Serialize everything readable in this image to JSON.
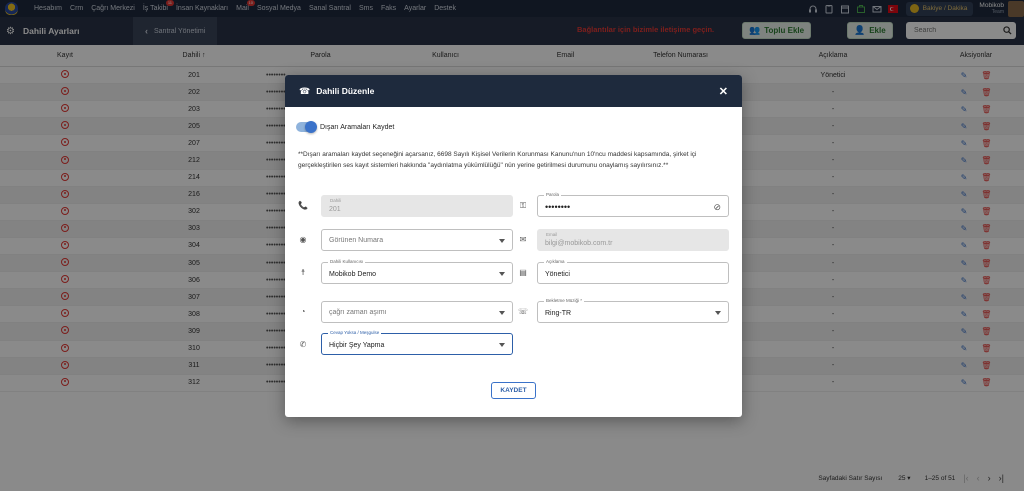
{
  "nav": {
    "items": [
      "Hesabım",
      "Crm",
      "Çağrı Merkezi",
      "İş Takibi",
      "İnsan Kaynakları",
      "Mail",
      "Sosyal Medya",
      "Sanal Santral",
      "Sms",
      "Faks",
      "Ayarlar",
      "Destek"
    ],
    "badges": {
      "is_takibi": "11",
      "mail": "10"
    },
    "bakiye_label": "Bakiye / Dakika",
    "user_name": "Mobikob",
    "user_sub": "Team"
  },
  "subhead": {
    "page_title": "Dahili Ayarları",
    "back_label": "Santral Yönetimi",
    "contact_note": "Bağlantılar için bizimle iletişime geçin.",
    "bulk_add_label": "Toplu Ekle",
    "add_label": "Ekle",
    "search_placeholder": "Search"
  },
  "table": {
    "headers": [
      "Kayıt",
      "Dahili ↑",
      "Parola",
      "Kullanıcı",
      "Email",
      "Telefon Numarası",
      "Açıklama",
      "Aksiyonlar"
    ],
    "rows": [
      {
        "dahili": "201",
        "aciklama": "Yönetici"
      },
      {
        "dahili": "202",
        "aciklama": "-"
      },
      {
        "dahili": "203",
        "aciklama": "-"
      },
      {
        "dahili": "205",
        "aciklama": "-"
      },
      {
        "dahili": "207",
        "aciklama": "-"
      },
      {
        "dahili": "212",
        "aciklama": "-"
      },
      {
        "dahili": "214",
        "aciklama": "-"
      },
      {
        "dahili": "216",
        "aciklama": "-"
      },
      {
        "dahili": "302",
        "aciklama": "-"
      },
      {
        "dahili": "303",
        "aciklama": "-"
      },
      {
        "dahili": "304",
        "aciklama": "-"
      },
      {
        "dahili": "305",
        "aciklama": "-"
      },
      {
        "dahili": "306",
        "aciklama": "-"
      },
      {
        "dahili": "307",
        "aciklama": "-"
      },
      {
        "dahili": "308",
        "aciklama": "-"
      },
      {
        "dahili": "309",
        "aciklama": "-"
      },
      {
        "dahili": "310",
        "aciklama": "-"
      },
      {
        "dahili": "311",
        "aciklama": "-"
      },
      {
        "dahili": "312",
        "aciklama": "-"
      }
    ],
    "password_mask": "••••••••"
  },
  "footer": {
    "rows_per_page_label": "Sayfadaki Satır Sayısı",
    "rows_per_page_value": "25",
    "range": "1–25 of 51"
  },
  "modal": {
    "title": "Dahili Düzenle",
    "toggle_label": "Dışarı Aramaları Kaydet",
    "notice": "**Dışarı aramaları kaydet seçeneğini açarsanız, 6698 Sayılı Kişisel Verilerin Korunması Kanunu'nun 10'ncu maddesi kapsamında, şirket içi gerçekleştirilen ses kayıt sistemleri hakkında \"aydınlatma yükümlülüğü\" nün yerine getirilmesi durumunu onaylamış sayılırsınız.**",
    "fields": {
      "dahili_label": "Dahili",
      "dahili_value": "201",
      "parola_label": "Parola",
      "parola_value": "••••••••",
      "gorunen_placeholder": "Görünen Numara",
      "email_label": "Email",
      "email_value": "bilgi@mobikob.com.tr",
      "kullanici_label": "Dahili Kullanıcısı",
      "kullanici_value": "Mobikob Demo",
      "aciklama_label": "Açıklama",
      "aciklama_value": "Yönetici",
      "zaman_placeholder": "çağrı zaman aşımı",
      "muzik_label": "Bekletme Müziği *",
      "muzik_value": "Ring-TR",
      "cevap_label": "Cevap Yoksa / Meşgulse",
      "cevap_value": "Hiçbir Şey Yapma"
    },
    "save_label": "KAYDET"
  },
  "colors": {
    "nav_bg": "#1e2a3d",
    "accent": "#3a72c9",
    "danger": "#e53935",
    "success": "#2e7d32"
  }
}
